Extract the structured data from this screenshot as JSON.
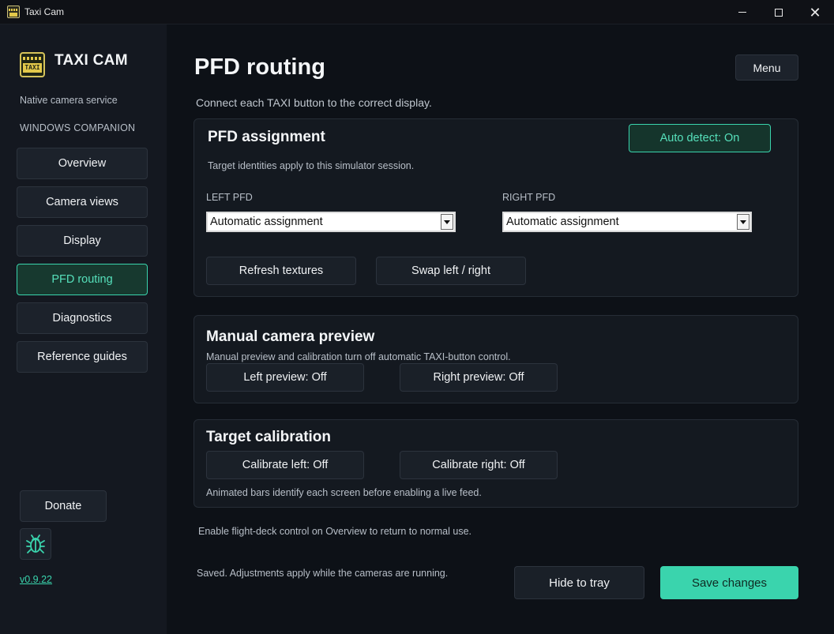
{
  "window": {
    "title": "Taxi Cam",
    "icons": {
      "app": "taxi-app-icon",
      "minimize": "minimize-icon",
      "maximize": "maximize-icon",
      "close": "close-icon"
    }
  },
  "sidebar": {
    "brand": "TAXI CAM",
    "logo_text": "TAXI",
    "tagline": "Native camera service",
    "section_label": "WINDOWS COMPANION",
    "items": [
      {
        "label": "Overview",
        "active": false
      },
      {
        "label": "Camera views",
        "active": false
      },
      {
        "label": "Display",
        "active": false
      },
      {
        "label": "PFD routing",
        "active": true
      },
      {
        "label": "Diagnostics",
        "active": false
      },
      {
        "label": "Reference guides",
        "active": false
      }
    ],
    "donate_label": "Donate",
    "bug_icon": "bug-icon",
    "version": "v0.9.22"
  },
  "header": {
    "title": "PFD routing",
    "menu_label": "Menu",
    "subtitle": "Connect each TAXI button to the correct display."
  },
  "pfd_assignment": {
    "title": "PFD assignment",
    "auto_detect_label": "Auto detect: On",
    "note": "Target identities apply to this simulator session.",
    "left_label": "LEFT PFD",
    "left_value": "Automatic assignment",
    "right_label": "RIGHT PFD",
    "right_value": "Automatic assignment",
    "refresh_label": "Refresh textures",
    "swap_label": "Swap left / right"
  },
  "manual_preview": {
    "title": "Manual camera preview",
    "note": "Manual preview and calibration turn off automatic TAXI-button control.",
    "left_label": "Left preview: Off",
    "right_label": "Right preview: Off"
  },
  "calibration": {
    "title": "Target calibration",
    "left_label": "Calibrate left: Off",
    "right_label": "Calibrate right: Off",
    "note": "Animated bars identify each screen before enabling a live feed."
  },
  "footer": {
    "note": "Enable flight-deck control on Overview to return to normal use.",
    "status": "Saved. Adjustments apply while the cameras are running.",
    "hide_label": "Hide to tray",
    "save_label": "Save changes"
  },
  "colors": {
    "accent": "#3ad4ad",
    "background": "#0d1117",
    "sidebar": "#141820",
    "card": "#141920"
  }
}
